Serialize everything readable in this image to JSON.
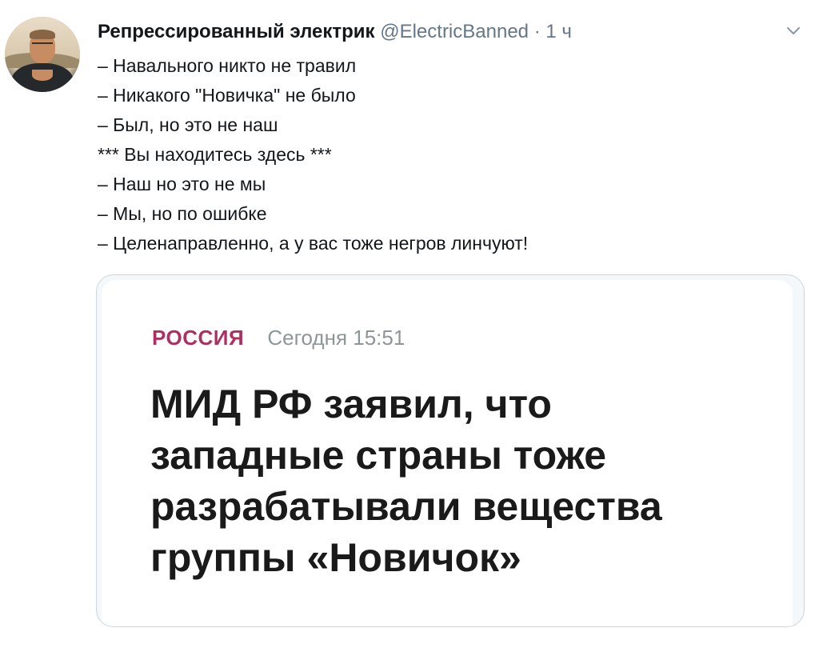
{
  "tweet": {
    "author_name": "Репрессированный электрик",
    "author_handle": "@ElectricBanned",
    "separator": "·",
    "time": "1 ч",
    "lines": [
      "– Навального никто не травил",
      "– Никакого \"Новичка\" не было",
      "– Был, но это не наш",
      "*** Вы находитесь здесь ***",
      "– Наш но это не мы",
      "– Мы, но по ошибке",
      "– Целенаправленно, а у вас тоже негров линчуют!"
    ]
  },
  "card": {
    "category": "РОССИЯ",
    "date": "Сегодня 15:51",
    "headline_lines": [
      "МИД РФ заявил, что",
      "западные страны тоже",
      "разрабатывали вещества",
      "группы «Новичок»"
    ]
  },
  "icons": {
    "menu": "chevron-down-icon"
  },
  "colors": {
    "category": "#b02f63",
    "handle": "#657786",
    "card_border": "#ccd6dd"
  }
}
